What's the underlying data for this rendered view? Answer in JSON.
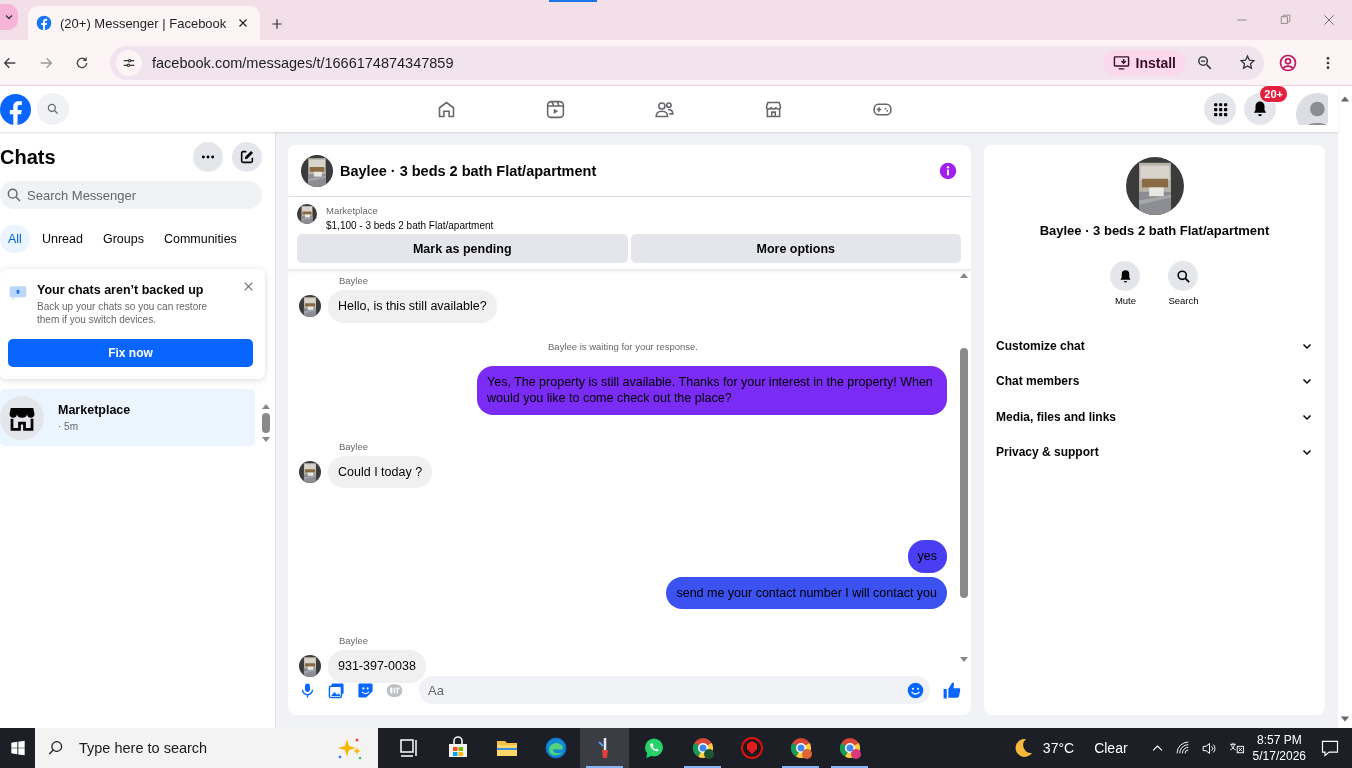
{
  "browser": {
    "tab_title": "(20+) Messenger | Facebook",
    "url": "facebook.com/messages/t/1666174874347859",
    "install_label": "Install"
  },
  "topbar": {
    "notification_badge": "20+"
  },
  "sidebar": {
    "title": "Chats",
    "search": {
      "placeholder": "Search Messenger"
    },
    "filters": [
      {
        "label": "All",
        "selected": true
      },
      {
        "label": "Unread",
        "selected": false
      },
      {
        "label": "Groups",
        "selected": false
      },
      {
        "label": "Communities",
        "selected": false
      }
    ],
    "backup_card": {
      "title": "Your chats aren’t backed up",
      "body": "Back up your chats so you can restore them if you switch devices.",
      "button": "Fix now"
    },
    "chats": [
      {
        "name": "Marketplace",
        "time": "· 5m",
        "selected": true
      }
    ]
  },
  "thread": {
    "title": "Baylee · 3 beds 2 bath Flat/apartment",
    "listing": {
      "label": "Marketplace",
      "title": "$1,100 - 3 beds 2 bath Flat/apartment"
    },
    "buttons": [
      "Mark as pending",
      "More options"
    ],
    "messages": [
      {
        "kind": "incoming",
        "sender": "Baylee",
        "text": "Hello, is this still available?"
      },
      {
        "kind": "status",
        "text": "Baylee is waiting for your response."
      },
      {
        "kind": "outgoing",
        "text": "Yes, The property is still available. Thanks for your interest in the property! When would you like to come check out the place?",
        "color": "#7a2cf5"
      },
      {
        "kind": "incoming",
        "sender": "Baylee",
        "text": "Could I today ?"
      },
      {
        "kind": "outgoing",
        "text": "yes",
        "color": "#4a3ef2"
      },
      {
        "kind": "outgoing",
        "text": "send me your contact number I will contact you",
        "color": "#3b52f0"
      },
      {
        "kind": "incoming",
        "sender": "Baylee",
        "text": "931-397-0038"
      }
    ],
    "composer": {
      "placeholder": "Aa"
    }
  },
  "info_panel": {
    "title": "Baylee · 3 beds 2 bath Flat/apartment",
    "actions": [
      {
        "kind": "mute",
        "label": "Mute"
      },
      {
        "kind": "search",
        "label": "Search"
      }
    ],
    "sections": [
      {
        "label": "Customize chat",
        "expanded": false
      },
      {
        "label": "Chat members",
        "expanded": false
      },
      {
        "label": "Media, files and links",
        "expanded": false
      },
      {
        "label": "Privacy & support",
        "expanded": false
      }
    ]
  },
  "taskbar": {
    "search_placeholder": "Type here to search",
    "weather": {
      "temperature": "37°C",
      "condition": "Clear"
    },
    "time": "8:57 PM",
    "date": "5/17/2026"
  }
}
